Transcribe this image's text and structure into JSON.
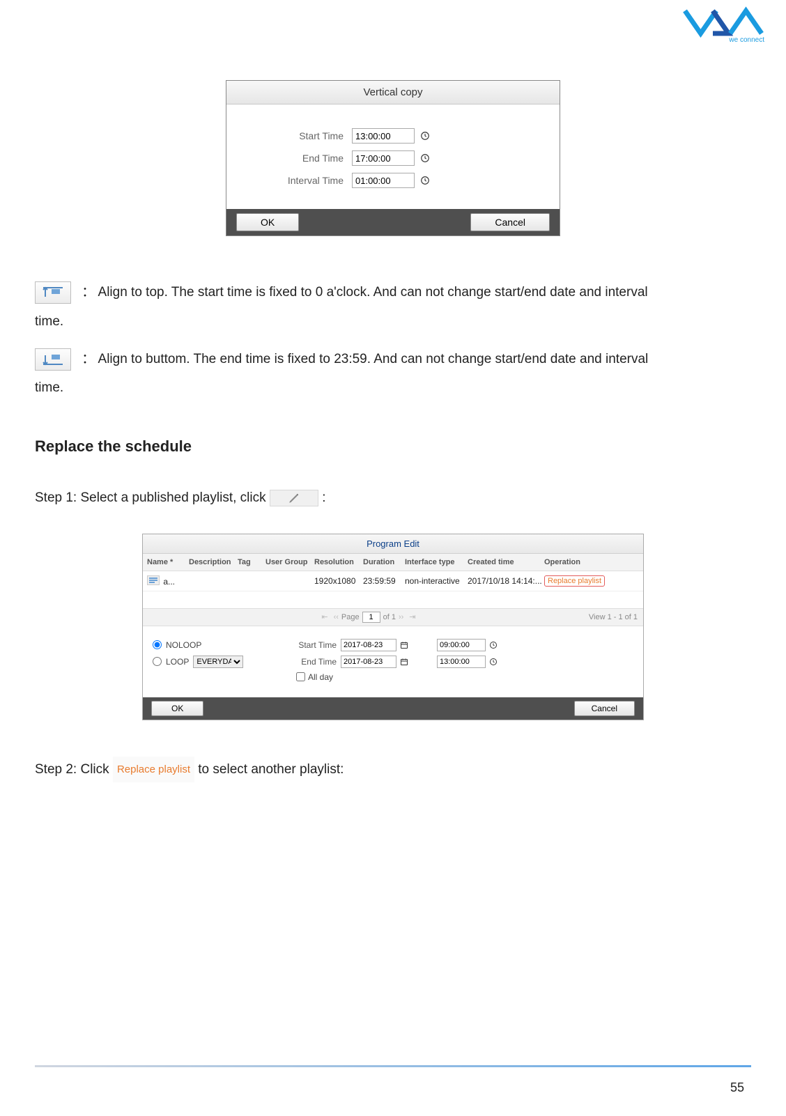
{
  "page_number": "55",
  "logo_tagline": "we connect",
  "dialog1": {
    "title": "Vertical copy",
    "start_label": "Start Time",
    "start_value": "13:00:00",
    "end_label": "End Time",
    "end_value": "17:00:00",
    "interval_label": "Interval Time",
    "interval_value": "01:00:00",
    "ok": "OK",
    "cancel": "Cancel"
  },
  "align_top": {
    "colon": "：",
    "text1": "Align to top. The start time is fixed to 0 a'clock. And can not change start/end date and interval",
    "text2": "time."
  },
  "align_bottom": {
    "colon": "：",
    "text1": "Align to buttom. The end time is fixed to 23:59. And can not change start/end date and interval",
    "text2": "time."
  },
  "section_heading": "Replace the schedule",
  "step1_pre": "Step 1: Select a published playlist, click",
  "step1_post": ":",
  "dialog2": {
    "title": "Program Edit",
    "headers": {
      "name": "Name *",
      "desc": "Description",
      "tag": "Tag",
      "ug": "User Group",
      "res": "Resolution",
      "dur": "Duration",
      "iftype": "Interface type",
      "created": "Created time",
      "op": "Operation"
    },
    "row": {
      "name": "a...",
      "res": "1920x1080",
      "dur": "23:59:59",
      "iftype": "non-interactive",
      "created": "2017/10/18 14:14:...",
      "op": "Replace playlist"
    },
    "pager": {
      "page_label_pre": "Page",
      "page_value": "1",
      "page_label_post": "of 1",
      "view": "View 1 - 1 of 1"
    },
    "noloop_label": "NOLOOP",
    "loop_label": "LOOP",
    "loop_select": "EVERYDAY",
    "start_label": "Start Time",
    "start_date": "2017-08-23",
    "start_time": "09:00:00",
    "end_label": "End Time",
    "end_date": "2017-08-23",
    "end_time": "13:00:00",
    "allday_label": "All day",
    "ok": "OK",
    "cancel": "Cancel"
  },
  "step2_pre": "Step 2: Click",
  "step2_btn": "Replace playlist",
  "step2_post": "to select another playlist:"
}
